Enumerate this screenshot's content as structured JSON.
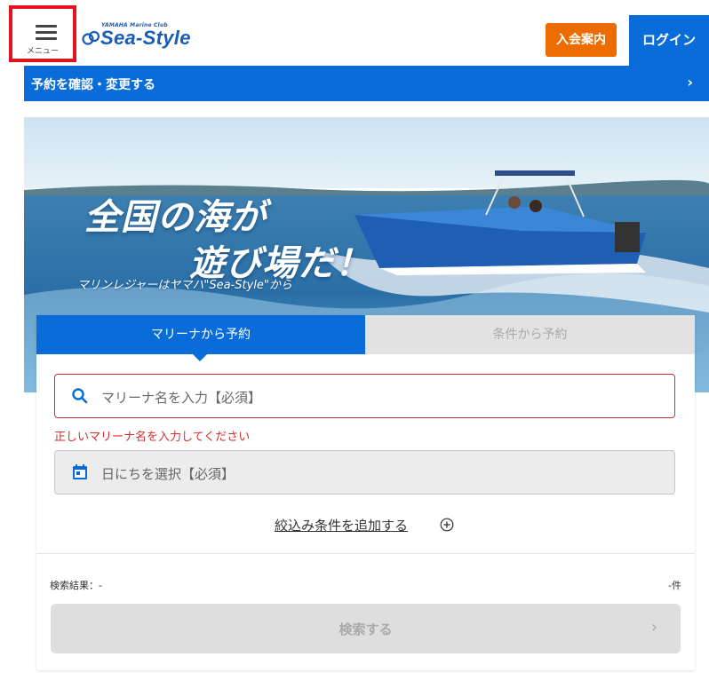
{
  "header": {
    "menu_label": "メニュー",
    "logo_small": "YAMAHA Marine Club",
    "logo_main": "Sea-Style",
    "join_label": "入会案内",
    "login_label": "ログイン"
  },
  "reserve_bar": {
    "label": "予約を確認・変更する",
    "chevron": "›"
  },
  "hero": {
    "title_line1": "全国の海が",
    "title_line2": "遊び場だ！",
    "tagline": "マリンレジャーはヤマハ\"Sea-Style\"から"
  },
  "search": {
    "tabs": [
      "マリーナから予約",
      "条件から予約"
    ],
    "active_tab": 0,
    "marina_placeholder": "マリーナ名を入力【必須】",
    "marina_error": "正しいマリーナ名を入力してください",
    "date_placeholder": "日にちを選択【必須】",
    "add_condition": "絞込み条件を追加する",
    "result_label": "検索結果：-",
    "result_count": "-件",
    "search_button": "検索する",
    "search_chevron": "›"
  },
  "colors": {
    "primary": "#0a6cd8",
    "accent_orange": "#ec6c00",
    "error_red": "#d32f2f",
    "highlight_border": "#e3141f"
  },
  "icons": {
    "menu": "hamburger-icon",
    "logo": "sea-style-logo-mark",
    "marina_field": "search-icon",
    "date_field": "calendar-icon",
    "add_condition": "plus-circle-icon",
    "chevron": "chevron-right-icon"
  }
}
